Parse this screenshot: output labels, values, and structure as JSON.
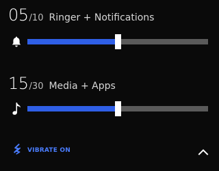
{
  "ringer": {
    "value": "05",
    "max": "/10",
    "label": "Ringer + Notifications",
    "level": 0.5,
    "icon": "bell-icon"
  },
  "media": {
    "value": "15",
    "max": "/30",
    "label": "Media + Apps",
    "level": 0.5,
    "icon": "music-note-icon"
  },
  "vibrate": {
    "label": "VIBRATE ON",
    "icon": "vibrate-icon"
  },
  "collapse": {
    "icon": "chevron-up-icon"
  },
  "colors": {
    "background": "#0a0a0a",
    "accent": "#2f5fe6",
    "track": "#5a5a5a",
    "thumb": "#ffffff",
    "vibrate": "#4a7dff"
  }
}
